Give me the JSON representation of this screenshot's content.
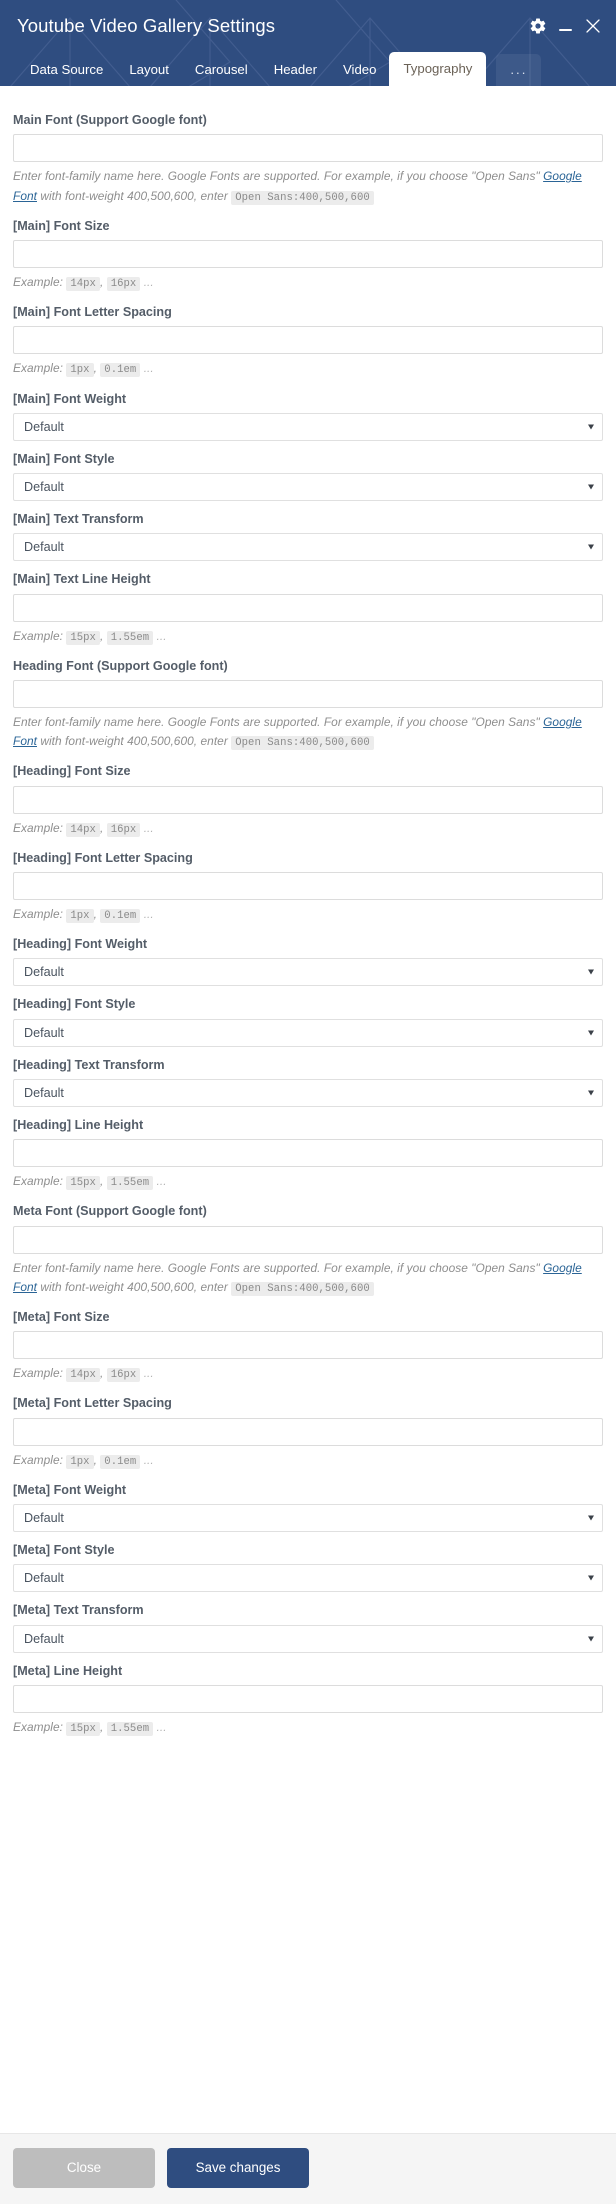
{
  "window": {
    "title": "Youtube Video Gallery Settings",
    "controls": [
      {
        "name": "settings-gear",
        "icon": "gear-icon"
      },
      {
        "name": "minimize",
        "icon": "minimize-icon"
      },
      {
        "name": "close",
        "icon": "close-icon"
      }
    ]
  },
  "tabs": [
    {
      "label": "Data Source",
      "active": false
    },
    {
      "label": "Layout",
      "active": false
    },
    {
      "label": "Carousel",
      "active": false
    },
    {
      "label": "Header",
      "active": false
    },
    {
      "label": "Video",
      "active": false
    },
    {
      "label": "Typography",
      "active": true
    },
    {
      "label": "...",
      "active": false,
      "overflow": true
    }
  ],
  "help": {
    "font_family_prefix": "Enter font-family name here. Google Fonts are supported. For example, if you choose \"Open Sans\" ",
    "google_font_link": "Google Font",
    "font_family_mid": " with font-weight 400,500,600, enter ",
    "font_family_code": "Open Sans:400,500,600",
    "example_label": "Example:",
    "size_example_1": "14px",
    "size_example_2": "16px",
    "spacing_example_1": "1px",
    "spacing_example_2": "0.1em",
    "lineheight_example_1": "15px",
    "lineheight_example_2": "1.55em",
    "comma": ",",
    "ellipsis": "..."
  },
  "fields": {
    "main_font": {
      "label": "Main Font (Support Google font)",
      "value": "",
      "placeholder": ""
    },
    "main_font_size": {
      "label": "[Main] Font Size",
      "value": "",
      "placeholder": ""
    },
    "main_letter_spacing": {
      "label": "[Main] Font Letter Spacing",
      "value": "",
      "placeholder": ""
    },
    "main_font_weight": {
      "label": "[Main] Font Weight",
      "value": "Default"
    },
    "main_font_style": {
      "label": "[Main] Font Style",
      "value": "Default"
    },
    "main_text_transform": {
      "label": "[Main] Text Transform",
      "value": "Default"
    },
    "main_line_height": {
      "label": "[Main] Text Line Height",
      "value": "",
      "placeholder": ""
    },
    "heading_font": {
      "label": "Heading Font (Support Google font)",
      "value": "",
      "placeholder": ""
    },
    "heading_font_size": {
      "label": "[Heading] Font Size",
      "value": "",
      "placeholder": ""
    },
    "heading_letter_spacing": {
      "label": "[Heading] Font Letter Spacing",
      "value": "",
      "placeholder": ""
    },
    "heading_font_weight": {
      "label": "[Heading] Font Weight",
      "value": "Default"
    },
    "heading_font_style": {
      "label": "[Heading] Font Style",
      "value": "Default"
    },
    "heading_text_transform": {
      "label": "[Heading] Text Transform",
      "value": "Default"
    },
    "heading_line_height": {
      "label": "[Heading] Line Height",
      "value": "",
      "placeholder": ""
    },
    "meta_font": {
      "label": "Meta Font (Support Google font)",
      "value": "",
      "placeholder": ""
    },
    "meta_font_size": {
      "label": "[Meta] Font Size",
      "value": "",
      "placeholder": ""
    },
    "meta_letter_spacing": {
      "label": "[Meta] Font Letter Spacing",
      "value": "",
      "placeholder": ""
    },
    "meta_font_weight": {
      "label": "[Meta] Font Weight",
      "value": "Default"
    },
    "meta_font_style": {
      "label": "[Meta] Font Style",
      "value": "Default"
    },
    "meta_text_transform": {
      "label": "[Meta] Text Transform",
      "value": "Default"
    },
    "meta_line_height": {
      "label": "[Meta] Line Height",
      "value": "",
      "placeholder": ""
    }
  },
  "select_options": [
    "Default"
  ],
  "footer": {
    "close_label": "Close",
    "save_label": "Save changes"
  },
  "colors": {
    "header_bg": "#2f4d80",
    "primary_button": "#2f4d80",
    "secondary_button": "#bdbdbd",
    "link": "#2a6496",
    "label_text": "#545d68",
    "help_text": "#8e8e8e"
  }
}
